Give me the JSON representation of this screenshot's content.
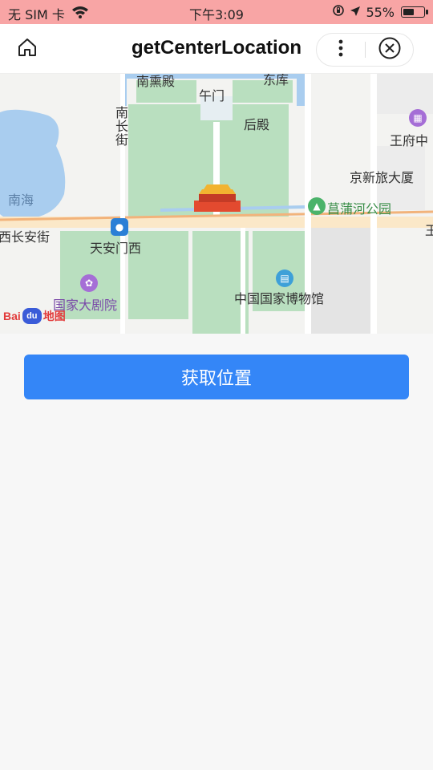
{
  "status_bar": {
    "carrier": "无 SIM 卡",
    "time": "下午3:09",
    "battery_percent": "55%",
    "battery_level": 0.55,
    "icons": [
      "wifi-icon",
      "rotation-lock-icon",
      "location-arrow-icon",
      "battery-icon"
    ]
  },
  "navbar": {
    "title": "getCenterLocation",
    "icons": [
      "home-icon",
      "more-vertical-icon",
      "close-circle-icon"
    ]
  },
  "map": {
    "labels": {
      "nanhudian": "南熏殿",
      "wumen": "午门",
      "dongku": "东库",
      "nanchangjie": "南长街",
      "houdian": "后殿",
      "nanhai": "南海",
      "wangfuzhong": "王府中",
      "jingxin": "京新旅大厦",
      "changpu": "菖蒲河公园",
      "xichangan": "西长安街",
      "tiananmenxi": "天安门西",
      "guojiadajuyuan": "国家大剧院",
      "guojiabowuguan": "中国国家博物馆",
      "edge_right": "王"
    },
    "logo_text": "Bai",
    "logo_du": "du",
    "logo_suffix": "地图"
  },
  "action": {
    "get_location_label": "获取位置"
  },
  "colors": {
    "status_bar_bg": "#f8a5a5",
    "primary_button": "#3486f7",
    "park_green": "#b9dfbf",
    "water_blue": "#a9cdef",
    "road": "#fbe8c8"
  }
}
